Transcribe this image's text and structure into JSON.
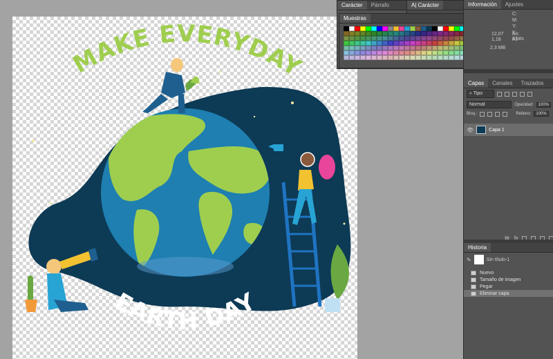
{
  "artwork": {
    "title_top": "MAKE EVERYDAY",
    "title_bottom": "EARTH DAY"
  },
  "character_panel": {
    "tabs": [
      "Carácter",
      "Párrafo"
    ],
    "swatches_tab": "Muestras",
    "sub_panel_tab": "Carácter"
  },
  "info_panel": {
    "tabs": [
      "Información",
      "Ajustes"
    ],
    "values": {
      "c": "C:",
      "m": "M:",
      "y": "Y:",
      "k": "K:",
      "bits": "8 bits",
      "x": "12,07",
      "y2": "1,18",
      "w": "An:",
      "h": "Al:",
      "doc": "2,3 MB"
    }
  },
  "layers_panel": {
    "tabs": [
      "Capas",
      "Canales",
      "Trazados"
    ],
    "filter_label": "Tipo",
    "blend_mode": "Normal",
    "opacity_label": "Opacidad:",
    "opacity_value": "100%",
    "lock_label": "Bloq.:",
    "fill_label": "Relleno:",
    "fill_value": "100%",
    "layers": [
      {
        "name": "Capa 1",
        "visible": true,
        "selected": true
      }
    ]
  },
  "history_panel": {
    "tab": "Historia",
    "snapshot": "Sin título-1",
    "states": [
      "Nuevo",
      "Tamaño de imagen",
      "Pegar",
      "Eliminar capa"
    ],
    "selected_index": 3
  },
  "colors": {
    "space": "#0d3a55",
    "ocean": "#1e7fb0",
    "land": "#9fce4f",
    "title_green": "#9fce4f",
    "pink_hair": "#e8459b",
    "ladder": "#1f74c2"
  }
}
